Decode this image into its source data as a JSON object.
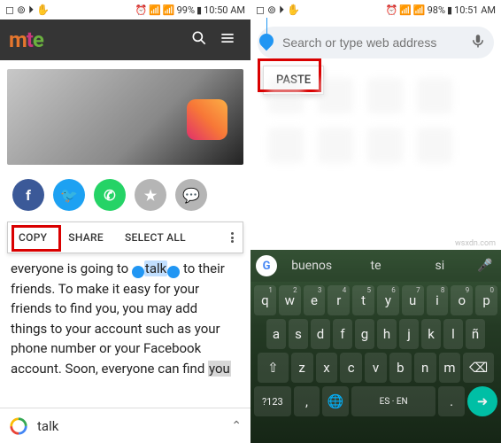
{
  "left": {
    "status": {
      "icons_left": "◻ ⊚ ⏵ ✋",
      "signal": "📶",
      "wifi": "📶",
      "battery_pct": "99%",
      "batt": "▮",
      "time": "10:50 AM",
      "alarm": "⏰"
    },
    "logo": {
      "m": "m",
      "t": "t",
      "e": "e"
    },
    "share": {
      "fb": "f",
      "tw": "🐦",
      "wa": "✆",
      "star": "★",
      "cmt": "💬"
    },
    "sel_menu": {
      "copy": "COPY",
      "share": "SHARE",
      "select_all": "SELECT ALL"
    },
    "article": {
      "line1": "everyone is going to ",
      "talk": "talk",
      "line1b": " to their",
      "line2": "friends. To make it easy for your",
      "line3": "friends to find you, you may add",
      "line4": "things to your account such as your",
      "line5": "phone number or your Facebook",
      "line6a": "account. Soon, everyone can find ",
      "you": "you"
    },
    "gbar": {
      "query": "talk",
      "chev": "⌃"
    }
  },
  "right": {
    "status": {
      "icons_left": "◻ ⊚ ⏵ ✋",
      "signal": "📶",
      "wifi": "📶",
      "battery_pct": "98%",
      "batt": "▮",
      "time": "10:51 AM",
      "alarm": "⏰"
    },
    "omnibox": {
      "placeholder": "Search or type web address"
    },
    "paste": "PASTE",
    "kbd": {
      "sug": {
        "g": "G",
        "s1": "buenos",
        "s2": "te",
        "s3": "si",
        "mic": "🎤"
      },
      "r1": [
        "q",
        "w",
        "e",
        "r",
        "t",
        "y",
        "u",
        "i",
        "o",
        "p"
      ],
      "r1n": [
        "1",
        "2",
        "3",
        "4",
        "5",
        "6",
        "7",
        "8",
        "9",
        "0"
      ],
      "r2": [
        "a",
        "s",
        "d",
        "f",
        "g",
        "h",
        "j",
        "k",
        "l",
        "ñ"
      ],
      "r3_shift": "⇧",
      "r3": [
        "z",
        "x",
        "c",
        "v",
        "b",
        "n",
        "m"
      ],
      "r3_bksp": "⌫",
      "r4": {
        "sym": "?123",
        "comma": ",",
        "lang": "🌐",
        "space": "ES · EN",
        "period": ".",
        "send": "➜"
      }
    },
    "watermark": "wsxdn.com"
  }
}
